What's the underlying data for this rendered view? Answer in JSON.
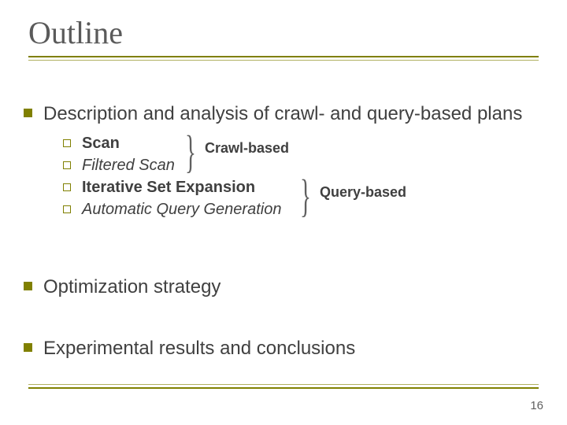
{
  "title": "Outline",
  "bullets": {
    "b1": "Description and analysis of crawl- and query-based plans",
    "b2": "Optimization strategy",
    "b3": "Experimental results and conclusions"
  },
  "sub": {
    "s1": "Scan",
    "s2": "Filtered Scan",
    "s3": "Iterative Set Expansion",
    "s4": "Automatic Query Generation"
  },
  "groups": {
    "g1": "Crawl-based",
    "g2": "Query-based"
  },
  "page": "16"
}
